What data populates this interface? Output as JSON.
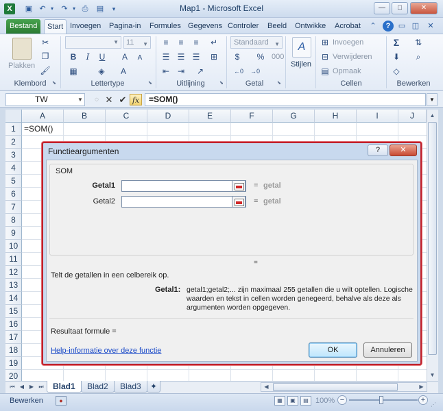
{
  "window": {
    "title": "Map1  -  Microsoft Excel",
    "app_icon": "X",
    "minimize": "—",
    "restore": "□",
    "close": "✕"
  },
  "quick_access": [
    "save-icon",
    "undo-icon",
    "redo-icon",
    "print-preview-icon",
    "customize-icon"
  ],
  "tabs": [
    {
      "label": "Bestand"
    },
    {
      "label": "Start"
    },
    {
      "label": "Invoegen"
    },
    {
      "label": "Pagina-in"
    },
    {
      "label": "Formules"
    },
    {
      "label": "Gegevens"
    },
    {
      "label": "Controler"
    },
    {
      "label": "Beeld"
    },
    {
      "label": "Ontwikke"
    },
    {
      "label": "Acrobat"
    }
  ],
  "ribbon": {
    "groups": [
      "Klembord",
      "Lettertype",
      "Uitlijning",
      "Getal",
      "Cellen",
      "Bewerken"
    ],
    "paste_label": "Plakken",
    "font_size": "11",
    "bold": "B",
    "italic": "I",
    "underline": "U",
    "number_format": "Standaard",
    "percent": "%",
    "thousands": "000",
    "styles_label": "Stijlen",
    "cells_insert": "Invoegen",
    "cells_delete": "Verwijderen",
    "cells_format": "Opmaak",
    "sum_symbol": "Σ"
  },
  "formula_bar": {
    "name_box": "TW",
    "formula": "=SOM()"
  },
  "grid": {
    "columns": [
      "A",
      "B",
      "C",
      "D",
      "E",
      "F",
      "G",
      "H",
      "I",
      "J"
    ],
    "rows": [
      "1",
      "2",
      "3",
      "4",
      "5",
      "6",
      "7",
      "8",
      "9",
      "10",
      "11",
      "12",
      "13",
      "14",
      "15",
      "16",
      "17",
      "18",
      "19",
      "20"
    ],
    "a1": "=SOM()"
  },
  "sheets": [
    {
      "label": "Blad1"
    },
    {
      "label": "Blad2"
    },
    {
      "label": "Blad3"
    }
  ],
  "status": {
    "mode": "Bewerken",
    "zoom": "100%",
    "zoom_fraction": 0.47
  },
  "dialog": {
    "title": "Functieargumenten",
    "help_button": "?",
    "close_button": "✕",
    "function_name": "SOM",
    "args": [
      {
        "label": "Getal1",
        "value": "",
        "result": "getal"
      },
      {
        "label": "Getal2",
        "value": "",
        "result": "getal"
      }
    ],
    "equals": "=",
    "function_description": "Telt de getallen in een celbereik op.",
    "arg_description_name": "Getal1:",
    "arg_description_text": "getal1;getal2;... zijn maximaal 255 getallen die u wilt optellen. Logische waarden en tekst in cellen worden genegeerd, behalve als deze als argumenten worden opgegeven.",
    "result_label": "Resultaat formule =",
    "help_link": "Help-informatie over deze functie",
    "ok": "OK",
    "cancel": "Annuleren"
  },
  "colors": {
    "accent_file_tab": "#2b7a32",
    "dialog_border": "#c1202a",
    "link": "#1848c8"
  }
}
